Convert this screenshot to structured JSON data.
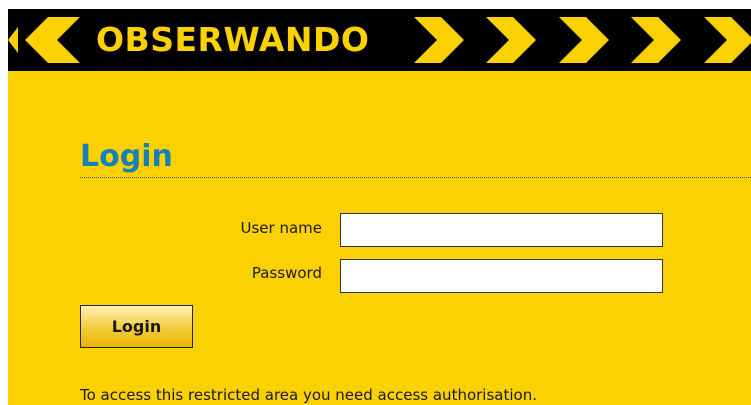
{
  "brand": {
    "logo_text": "OBSERWANDO",
    "colors": {
      "yellow": "#fcd101",
      "black": "#000000",
      "title_blue": "#1681b5"
    }
  },
  "login": {
    "title": "Login",
    "username_label": "User name",
    "username_value": "",
    "password_label": "Password",
    "password_value": "",
    "submit_label": "Login",
    "notice": "To access this restricted area you need access authorisation."
  },
  "icons": {
    "left_arrow": "chevron-left-icon",
    "right_arrows": "chevron-right-icon"
  }
}
